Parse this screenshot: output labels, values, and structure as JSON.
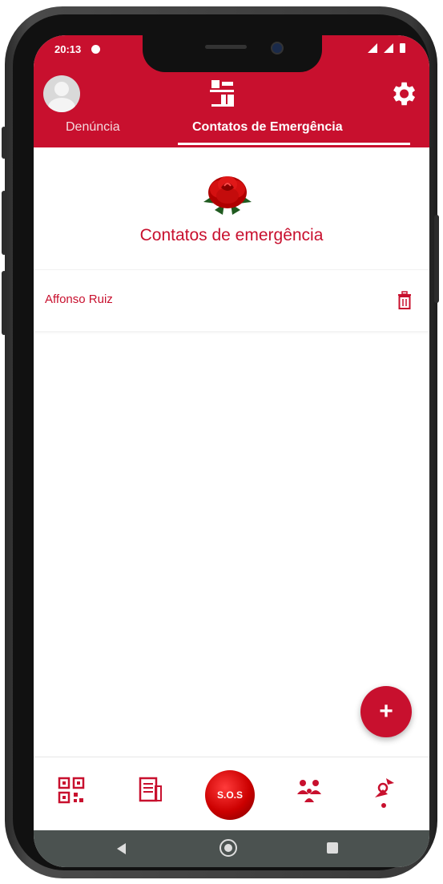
{
  "status_bar": {
    "time": "20:13"
  },
  "header": {
    "avatar_icon": "user-avatar-icon",
    "logo_icon": "app-logo-icon",
    "settings_icon": "gear-icon",
    "tabs": [
      {
        "label": "Denúncia",
        "active": false
      },
      {
        "label": "Contatos de Emergência",
        "active": true
      }
    ]
  },
  "main": {
    "rose_icon": "rose-icon",
    "title": "Contatos de emergência",
    "contacts": [
      {
        "name": "Affonso Ruiz",
        "delete_icon": "trash-icon"
      }
    ]
  },
  "fab": {
    "label": "+"
  },
  "bottom_nav": {
    "items": [
      {
        "icon": "qr-code-icon"
      },
      {
        "icon": "document-icon"
      },
      {
        "label": "S.O.S"
      },
      {
        "icon": "people-icon"
      },
      {
        "icon": "location-icon"
      }
    ]
  },
  "colors": {
    "brand": "#c8102e",
    "background": "#ffffff",
    "system_nav": "#4b5250"
  }
}
